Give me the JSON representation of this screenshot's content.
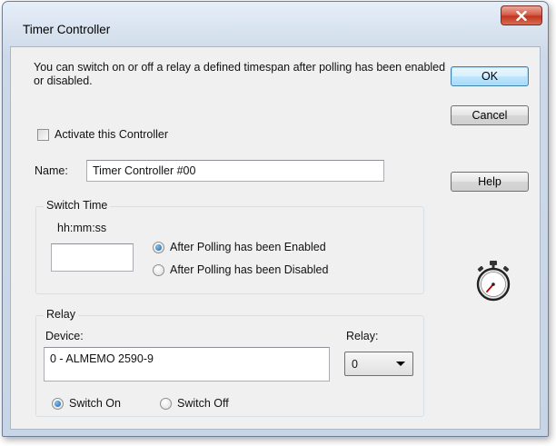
{
  "window": {
    "title": "Timer Controller"
  },
  "description": "You can switch on or off a relay a defined timespan after polling has been enabled or disabled.",
  "buttons": {
    "ok": "OK",
    "cancel": "Cancel",
    "help": "Help"
  },
  "activate": {
    "label": "Activate this Controller",
    "checked": false
  },
  "name_field": {
    "label": "Name:",
    "value": "Timer Controller #00"
  },
  "switch_time": {
    "group_label": "Switch Time",
    "format_label": "hh:mm:ss",
    "value": "",
    "options": [
      {
        "label": "After Polling has been Enabled",
        "selected": true
      },
      {
        "label": "After Polling has been Disabled",
        "selected": false
      }
    ]
  },
  "relay": {
    "group_label": "Relay",
    "device_label": "Device:",
    "device_value": "0 - ALMEMO 2590-9",
    "relay_label": "Relay:",
    "relay_value": "0",
    "options": [
      {
        "label": "Switch On",
        "selected": true
      },
      {
        "label": "Switch Off",
        "selected": false
      }
    ]
  },
  "icons": {
    "close": "close-icon",
    "stopwatch": "stopwatch-icon"
  }
}
